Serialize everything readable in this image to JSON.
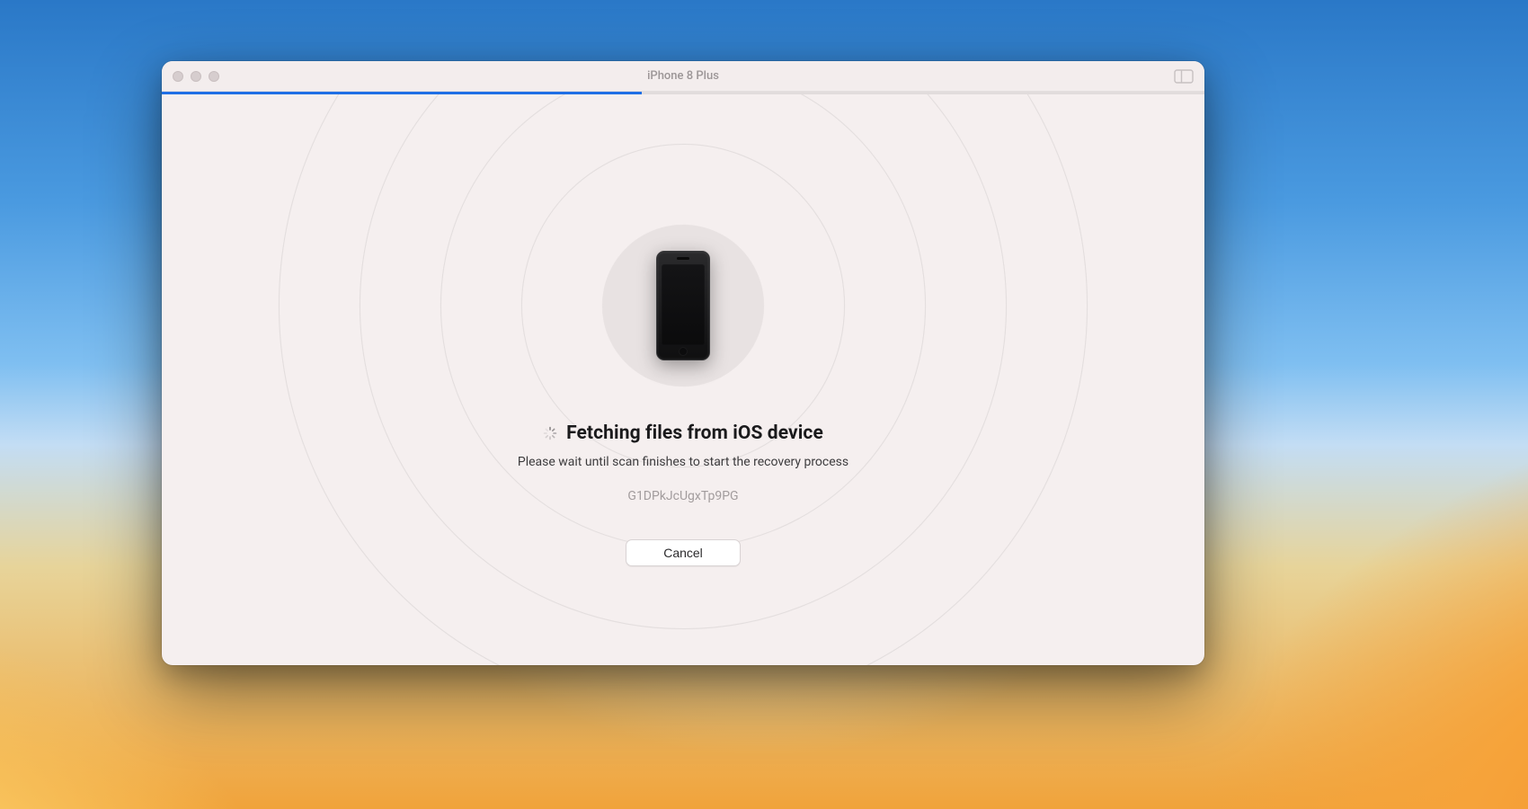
{
  "window": {
    "title": "iPhone 8 Plus"
  },
  "progress": {
    "percent": 46
  },
  "status": {
    "heading": "Fetching files from iOS device",
    "subtitle": "Please wait until scan finishes to start the recovery process",
    "device_identifier": "G1DPkJcUgxTp9PG"
  },
  "buttons": {
    "cancel": "Cancel"
  }
}
